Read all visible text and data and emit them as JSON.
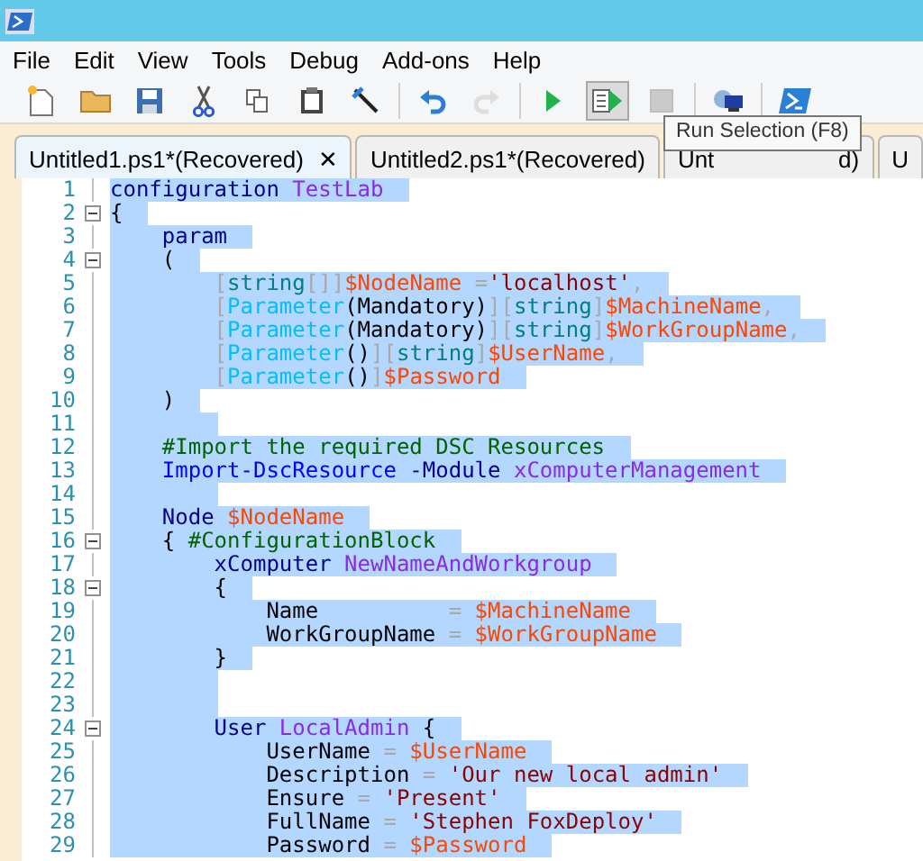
{
  "menu": [
    "File",
    "Edit",
    "View",
    "Tools",
    "Debug",
    "Add-ons",
    "Help"
  ],
  "toolbar": [
    {
      "kind": "new",
      "disabled": false,
      "pressed": false
    },
    {
      "kind": "open",
      "disabled": false,
      "pressed": false
    },
    {
      "kind": "save",
      "disabled": false,
      "pressed": false
    },
    {
      "kind": "cut",
      "disabled": false,
      "pressed": false
    },
    {
      "kind": "copy",
      "disabled": false,
      "pressed": false
    },
    {
      "kind": "paste",
      "disabled": false,
      "pressed": false
    },
    {
      "kind": "clear",
      "disabled": false,
      "pressed": false
    },
    {
      "kind": "undo",
      "disabled": false,
      "pressed": false
    },
    {
      "kind": "redo",
      "disabled": true,
      "pressed": false
    },
    {
      "kind": "run",
      "disabled": false,
      "pressed": false
    },
    {
      "kind": "runselection",
      "disabled": false,
      "pressed": true
    },
    {
      "kind": "stop",
      "disabled": true,
      "pressed": false
    },
    {
      "kind": "remote",
      "disabled": false,
      "pressed": false
    },
    {
      "kind": "console",
      "disabled": false,
      "pressed": false
    }
  ],
  "tooltip": "Run Selection (F8)",
  "tabs": [
    {
      "label": "Untitled1.ps1*(Recovered)",
      "selected": true,
      "close": "✕"
    },
    {
      "label": "Untitled2.ps1*(Recovered)",
      "selected": false
    },
    {
      "label": "Unt",
      "label_end": "d)",
      "selected": false
    },
    {
      "label": "U",
      "selected": false
    }
  ],
  "lines": [
    {
      "number": "1",
      "foldable": false,
      "selected": true,
      "tokens": [
        {
          "kind": "keyword",
          "text": "configuration "
        },
        {
          "kind": "name",
          "text": "TestLab"
        }
      ]
    },
    {
      "number": "2",
      "foldable": true,
      "selected": true,
      "tokens": [
        {
          "kind": "plain",
          "text": "{"
        }
      ]
    },
    {
      "number": "3",
      "foldable": false,
      "selected": true,
      "tokens": [
        {
          "kind": "keyword",
          "text": "    param"
        }
      ]
    },
    {
      "number": "4",
      "foldable": true,
      "selected": true,
      "tokens": [
        {
          "kind": "plain",
          "text": "    ("
        }
      ]
    },
    {
      "number": "5",
      "foldable": false,
      "selected": true,
      "tokens": [
        {
          "kind": "punct",
          "text": "        ["
        },
        {
          "kind": "type",
          "text": "string"
        },
        {
          "kind": "punct",
          "text": "[]]"
        },
        {
          "kind": "variable",
          "text": "$NodeName "
        },
        {
          "kind": "punct",
          "text": "="
        },
        {
          "kind": "string",
          "text": "'localhost'"
        },
        {
          "kind": "punct",
          "text": ","
        }
      ]
    },
    {
      "number": "6",
      "foldable": false,
      "selected": true,
      "tokens": [
        {
          "kind": "punct",
          "text": "        ["
        },
        {
          "kind": "attribute",
          "text": "Parameter"
        },
        {
          "kind": "plain",
          "text": "(Mandatory)"
        },
        {
          "kind": "punct",
          "text": "]["
        },
        {
          "kind": "type",
          "text": "string"
        },
        {
          "kind": "punct",
          "text": "]"
        },
        {
          "kind": "variable",
          "text": "$MachineName"
        },
        {
          "kind": "punct",
          "text": ","
        }
      ]
    },
    {
      "number": "7",
      "foldable": false,
      "selected": true,
      "tokens": [
        {
          "kind": "punct",
          "text": "        ["
        },
        {
          "kind": "attribute",
          "text": "Parameter"
        },
        {
          "kind": "plain",
          "text": "(Mandatory)"
        },
        {
          "kind": "punct",
          "text": "]["
        },
        {
          "kind": "type",
          "text": "string"
        },
        {
          "kind": "punct",
          "text": "]"
        },
        {
          "kind": "variable",
          "text": "$WorkGroupName"
        },
        {
          "kind": "punct",
          "text": ","
        }
      ]
    },
    {
      "number": "8",
      "foldable": false,
      "selected": true,
      "tokens": [
        {
          "kind": "punct",
          "text": "        ["
        },
        {
          "kind": "attribute",
          "text": "Parameter"
        },
        {
          "kind": "plain",
          "text": "()"
        },
        {
          "kind": "punct",
          "text": "]["
        },
        {
          "kind": "type",
          "text": "string"
        },
        {
          "kind": "punct",
          "text": "]"
        },
        {
          "kind": "variable",
          "text": "$UserName"
        },
        {
          "kind": "punct",
          "text": ","
        }
      ]
    },
    {
      "number": "9",
      "foldable": false,
      "selected": true,
      "tokens": [
        {
          "kind": "punct",
          "text": "        ["
        },
        {
          "kind": "attribute",
          "text": "Parameter"
        },
        {
          "kind": "plain",
          "text": "()"
        },
        {
          "kind": "punct",
          "text": "]"
        },
        {
          "kind": "variable",
          "text": "$Password"
        }
      ]
    },
    {
      "number": "10",
      "foldable": false,
      "selected": true,
      "tokens": [
        {
          "kind": "plain",
          "text": "    )"
        }
      ]
    },
    {
      "number": "11",
      "foldable": false,
      "selected": true
    },
    {
      "number": "12",
      "foldable": false,
      "selected": true,
      "tokens": [
        {
          "kind": "comment",
          "text": "    #Import the required DSC Resources"
        }
      ]
    },
    {
      "number": "13",
      "foldable": false,
      "selected": true,
      "tokens": [
        {
          "kind": "command",
          "text": "    Import-DscResource "
        },
        {
          "kind": "keyword",
          "text": "-Module "
        },
        {
          "kind": "name",
          "text": "xComputerManagement"
        }
      ]
    },
    {
      "number": "14",
      "foldable": false,
      "selected": true
    },
    {
      "number": "15",
      "foldable": false,
      "selected": true,
      "tokens": [
        {
          "kind": "keyword",
          "text": "    Node "
        },
        {
          "kind": "variable",
          "text": "$NodeName"
        }
      ]
    },
    {
      "number": "16",
      "foldable": true,
      "selected": true,
      "tokens": [
        {
          "kind": "plain",
          "text": "    { "
        },
        {
          "kind": "comment",
          "text": "#ConfigurationBlock"
        }
      ]
    },
    {
      "number": "17",
      "foldable": false,
      "selected": true,
      "tokens": [
        {
          "kind": "keyword",
          "text": "        xComputer "
        },
        {
          "kind": "name",
          "text": "NewNameAndWorkgroup"
        }
      ]
    },
    {
      "number": "18",
      "foldable": true,
      "selected": true,
      "tokens": [
        {
          "kind": "plain",
          "text": "        {"
        }
      ]
    },
    {
      "number": "19",
      "foldable": false,
      "selected": true,
      "tokens": [
        {
          "kind": "plain",
          "text": "            Name          "
        },
        {
          "kind": "punct",
          "text": "= "
        },
        {
          "kind": "variable",
          "text": "$MachineName"
        }
      ]
    },
    {
      "number": "20",
      "foldable": false,
      "selected": true,
      "tokens": [
        {
          "kind": "plain",
          "text": "            WorkGroupName "
        },
        {
          "kind": "punct",
          "text": "= "
        },
        {
          "kind": "variable",
          "text": "$WorkGroupName"
        }
      ]
    },
    {
      "number": "21",
      "foldable": false,
      "selected": true,
      "tokens": [
        {
          "kind": "plain",
          "text": "        }"
        }
      ]
    },
    {
      "number": "22",
      "foldable": false,
      "selected": true
    },
    {
      "number": "23",
      "foldable": false,
      "selected": true
    },
    {
      "number": "24",
      "foldable": true,
      "selected": true,
      "tokens": [
        {
          "kind": "keyword",
          "text": "        User "
        },
        {
          "kind": "name",
          "text": "LocalAdmin "
        },
        {
          "kind": "plain",
          "text": "{"
        }
      ]
    },
    {
      "number": "25",
      "foldable": false,
      "selected": true,
      "tokens": [
        {
          "kind": "plain",
          "text": "            UserName "
        },
        {
          "kind": "punct",
          "text": "= "
        },
        {
          "kind": "variable",
          "text": "$UserName"
        }
      ]
    },
    {
      "number": "26",
      "foldable": false,
      "selected": true,
      "tokens": [
        {
          "kind": "plain",
          "text": "            Description "
        },
        {
          "kind": "punct",
          "text": "= "
        },
        {
          "kind": "string",
          "text": "'Our new local admin'"
        }
      ]
    },
    {
      "number": "27",
      "foldable": false,
      "selected": true,
      "tokens": [
        {
          "kind": "plain",
          "text": "            Ensure "
        },
        {
          "kind": "punct",
          "text": "= "
        },
        {
          "kind": "string",
          "text": "'Present'"
        }
      ]
    },
    {
      "number": "28",
      "foldable": false,
      "selected": true,
      "tokens": [
        {
          "kind": "plain",
          "text": "            FullName "
        },
        {
          "kind": "punct",
          "text": "= "
        },
        {
          "kind": "string",
          "text": "'Stephen FoxDeploy'"
        }
      ]
    },
    {
      "number": "29",
      "foldable": false,
      "selected": true,
      "tokens": [
        {
          "kind": "plain",
          "text": "            Password "
        },
        {
          "kind": "punct",
          "text": "= "
        },
        {
          "kind": "variable",
          "text": "$Password"
        }
      ]
    }
  ]
}
